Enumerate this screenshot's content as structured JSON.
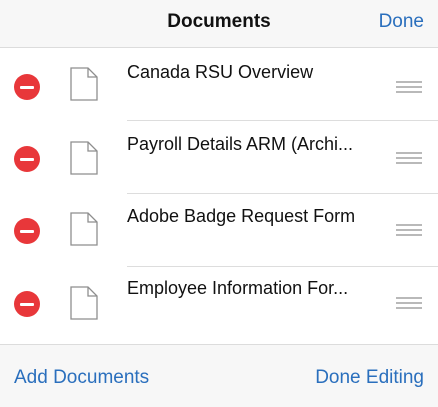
{
  "nav": {
    "title": "Documents",
    "done_label": "Done"
  },
  "documents": [
    {
      "name": "Canada RSU Overview"
    },
    {
      "name": "Payroll Details ARM (Archi..."
    },
    {
      "name": "Adobe Badge Request Form"
    },
    {
      "name": "Employee Information For..."
    }
  ],
  "icons": {
    "delete": "minus-circle-icon",
    "document": "document-icon",
    "reorder": "reorder-handle-icon"
  },
  "colors": {
    "accent": "#2a6fbd",
    "delete": "#e8373a"
  },
  "toolbar": {
    "add_label": "Add Documents",
    "done_editing_label": "Done Editing"
  }
}
